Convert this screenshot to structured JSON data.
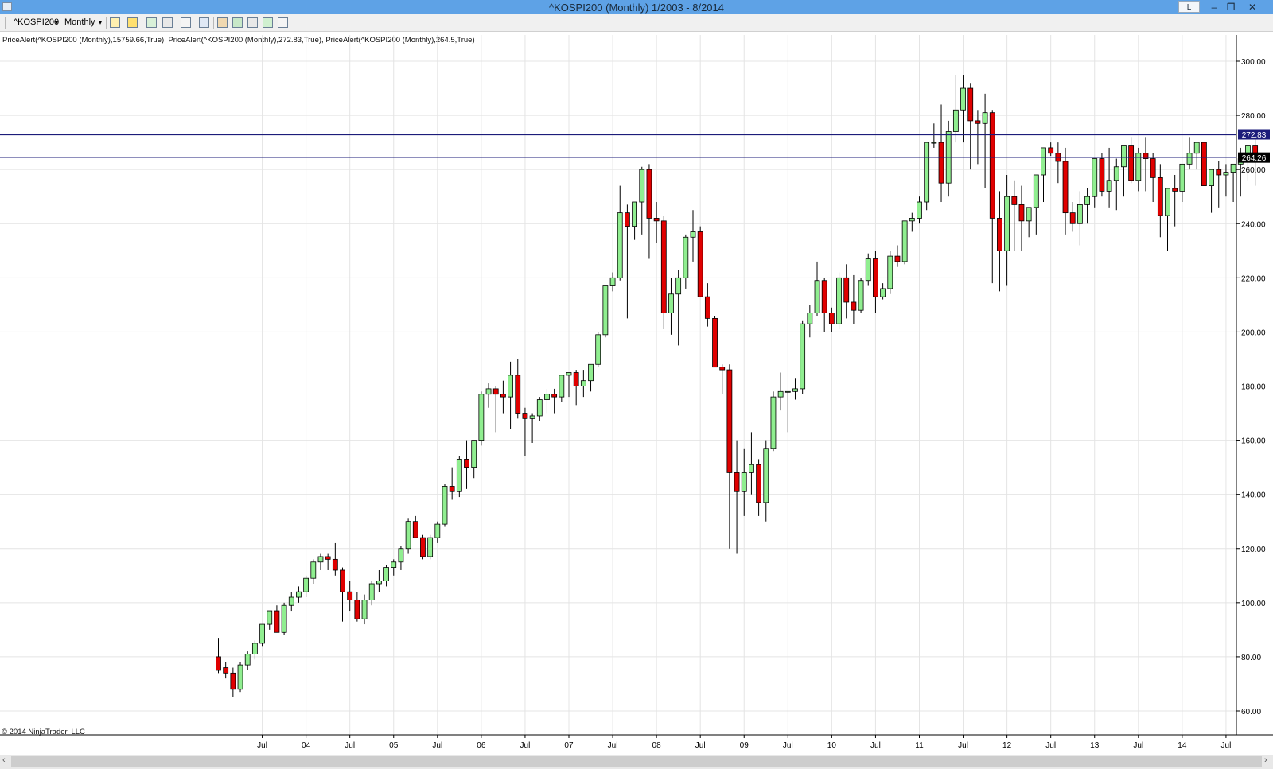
{
  "window": {
    "title": "^KOSPI200 (Monthly)  1/2003 - 8/2014",
    "btn_l": "L",
    "btn_min": "–",
    "btn_restore": "❐",
    "btn_close": "✕"
  },
  "toolbar": {
    "instrument": "^KOSPI200",
    "period": "Monthly",
    "icons": [
      "chart-style-icon",
      "drawing-pencil-icon",
      "indicator-icon",
      "strategy-icon",
      "cursor-icon",
      "zoom-icon",
      "data-box-icon",
      "properties-icon",
      "share-icon",
      "export-icon",
      "layout-icon"
    ]
  },
  "indicators_label": "PriceAlert(^KOSPI200 (Monthly),15759.66,True), PriceAlert(^KOSPI200 (Monthly),272.83,True), PriceAlert(^KOSPI200 (Monthly),264.5,True)",
  "copyright": "© 2014 NinjaTrader, LLC",
  "colors": {
    "up": "#90ee90",
    "down": "#e00000",
    "alert_line": "#1c1c7a",
    "alert_label_bg": "#1c1c7a",
    "last_label_bg": "#000000",
    "grid": "#e4e4e4"
  },
  "chart_data": {
    "type": "candlestick",
    "title": "^KOSPI200 (Monthly)  1/2003 - 8/2014",
    "ylim": [
      55,
      310
    ],
    "y_ticks": [
      "300.00",
      "280.00",
      "260.00",
      "240.00",
      "220.00",
      "200.00",
      "180.00",
      "160.00",
      "140.00",
      "120.00",
      "100.00",
      "80.00",
      "60.00"
    ],
    "x_tick_labels": [
      "Jul",
      "04",
      "Jul",
      "05",
      "Jul",
      "06",
      "Jul",
      "07",
      "Jul",
      "08",
      "Jul",
      "09",
      "Jul",
      "10",
      "Jul",
      "11",
      "Jul",
      "12",
      "Jul",
      "13",
      "Jul",
      "14",
      "Jul"
    ],
    "x_tick_months": [
      "2003-07",
      "2004-01",
      "2004-07",
      "2005-01",
      "2005-07",
      "2006-01",
      "2006-07",
      "2007-01",
      "2007-07",
      "2008-01",
      "2008-07",
      "2009-01",
      "2009-07",
      "2010-01",
      "2010-07",
      "2011-01",
      "2011-07",
      "2012-01",
      "2012-07",
      "2013-01",
      "2013-07",
      "2014-01",
      "2014-07"
    ],
    "first_month": "2003-01",
    "candles": [
      [
        80,
        87,
        74,
        75
      ],
      [
        76,
        78,
        72,
        74
      ],
      [
        74,
        76,
        65,
        68
      ],
      [
        68,
        78,
        67,
        77
      ],
      [
        77,
        82,
        75,
        81
      ],
      [
        81,
        86,
        79,
        85
      ],
      [
        85,
        92,
        84,
        92
      ],
      [
        92,
        97,
        90,
        97
      ],
      [
        97,
        99,
        89,
        89
      ],
      [
        89,
        100,
        88,
        99
      ],
      [
        99,
        104,
        97,
        102
      ],
      [
        102,
        106,
        100,
        104
      ],
      [
        104,
        110,
        102,
        109
      ],
      [
        109,
        116,
        107,
        115
      ],
      [
        115,
        118,
        112,
        117
      ],
      [
        117,
        118,
        112,
        116
      ],
      [
        116,
        122,
        110,
        112
      ],
      [
        112,
        113,
        93,
        104
      ],
      [
        104,
        108,
        97,
        101
      ],
      [
        101,
        104,
        93,
        94
      ],
      [
        94,
        103,
        92,
        101
      ],
      [
        101,
        108,
        99,
        107
      ],
      [
        107,
        112,
        104,
        108
      ],
      [
        108,
        114,
        106,
        113
      ],
      [
        113,
        116,
        110,
        115
      ],
      [
        115,
        121,
        112,
        120
      ],
      [
        120,
        131,
        118,
        130
      ],
      [
        130,
        132,
        124,
        124
      ],
      [
        124,
        125,
        116,
        117
      ],
      [
        117,
        125,
        116,
        124
      ],
      [
        124,
        130,
        122,
        129
      ],
      [
        129,
        144,
        128,
        143
      ],
      [
        143,
        150,
        138,
        141
      ],
      [
        141,
        154,
        139,
        153
      ],
      [
        153,
        160,
        142,
        150
      ],
      [
        150,
        160,
        146,
        160
      ],
      [
        160,
        178,
        158,
        177
      ],
      [
        177,
        181,
        172,
        179
      ],
      [
        179,
        180,
        163,
        177
      ],
      [
        177,
        182,
        170,
        176
      ],
      [
        176,
        189,
        164,
        184
      ],
      [
        184,
        190,
        168,
        170
      ],
      [
        170,
        172,
        154,
        168
      ],
      [
        168,
        170,
        159,
        169
      ],
      [
        169,
        176,
        167,
        175
      ],
      [
        175,
        179,
        170,
        177
      ],
      [
        177,
        179,
        170,
        176
      ],
      [
        176,
        184,
        174,
        184
      ],
      [
        184,
        185,
        176,
        185
      ],
      [
        185,
        186,
        173,
        180
      ],
      [
        180,
        186,
        176,
        182
      ],
      [
        182,
        188,
        178,
        188
      ],
      [
        188,
        200,
        187,
        199
      ],
      [
        199,
        217,
        198,
        217
      ],
      [
        217,
        222,
        215,
        220
      ],
      [
        220,
        254,
        219,
        244
      ],
      [
        244,
        247,
        205,
        239
      ],
      [
        239,
        247,
        234,
        248
      ],
      [
        248,
        261,
        236,
        260
      ],
      [
        260,
        262,
        227,
        242
      ],
      [
        242,
        248,
        233,
        241
      ],
      [
        241,
        243,
        201,
        207
      ],
      [
        207,
        220,
        199,
        214
      ],
      [
        214,
        223,
        195,
        220
      ],
      [
        220,
        236,
        216,
        235
      ],
      [
        235,
        245,
        226,
        237
      ],
      [
        237,
        239,
        213,
        213
      ],
      [
        213,
        218,
        202,
        205
      ],
      [
        205,
        206,
        187,
        187
      ],
      [
        187,
        188,
        177,
        186
      ],
      [
        186,
        188,
        120,
        148
      ],
      [
        148,
        160,
        118,
        141
      ],
      [
        141,
        157,
        132,
        148
      ],
      [
        148,
        163,
        140,
        151
      ],
      [
        151,
        153,
        132,
        137
      ],
      [
        137,
        160,
        130,
        157
      ],
      [
        157,
        178,
        156,
        176
      ],
      [
        176,
        185,
        171,
        178
      ],
      [
        178,
        178,
        163,
        178
      ],
      [
        178,
        183,
        175,
        179
      ],
      [
        179,
        204,
        177,
        203
      ],
      [
        203,
        210,
        198,
        207
      ],
      [
        207,
        226,
        206,
        219
      ],
      [
        219,
        220,
        200,
        207
      ],
      [
        207,
        209,
        200,
        203
      ],
      [
        203,
        222,
        201,
        220
      ],
      [
        220,
        225,
        205,
        211
      ],
      [
        211,
        221,
        203,
        208
      ],
      [
        208,
        220,
        207,
        219
      ],
      [
        219,
        229,
        217,
        227
      ],
      [
        227,
        230,
        207,
        213
      ],
      [
        213,
        218,
        212,
        216
      ],
      [
        216,
        230,
        214,
        228
      ],
      [
        228,
        232,
        224,
        226
      ],
      [
        226,
        240,
        225,
        241
      ],
      [
        241,
        244,
        237,
        242
      ],
      [
        242,
        250,
        240,
        248
      ],
      [
        248,
        265,
        245,
        270
      ],
      [
        270,
        277,
        268,
        270
      ],
      [
        270,
        284,
        248,
        255
      ],
      [
        255,
        278,
        250,
        274
      ],
      [
        274,
        295,
        270,
        282
      ],
      [
        282,
        295,
        270,
        290
      ],
      [
        290,
        292,
        260,
        278
      ],
      [
        278,
        282,
        262,
        277
      ],
      [
        277,
        288,
        253,
        281
      ],
      [
        281,
        282,
        218,
        242
      ],
      [
        242,
        252,
        215,
        230
      ],
      [
        230,
        258,
        217,
        250
      ],
      [
        250,
        256,
        230,
        247
      ],
      [
        247,
        254,
        230,
        241
      ],
      [
        241,
        245,
        235,
        246
      ],
      [
        246,
        256,
        236,
        258
      ],
      [
        258,
        263,
        248,
        268
      ],
      [
        268,
        270,
        265,
        266
      ],
      [
        266,
        270,
        255,
        263
      ],
      [
        263,
        268,
        236,
        244
      ],
      [
        244,
        248,
        237,
        240
      ],
      [
        240,
        252,
        232,
        247
      ],
      [
        247,
        253,
        240,
        250
      ],
      [
        250,
        260,
        246,
        264
      ],
      [
        264,
        266,
        250,
        252
      ],
      [
        252,
        268,
        246,
        256
      ],
      [
        256,
        264,
        245,
        261
      ],
      [
        261,
        266,
        250,
        269
      ],
      [
        269,
        272,
        255,
        256
      ],
      [
        256,
        268,
        252,
        266
      ],
      [
        266,
        272,
        252,
        264
      ],
      [
        264,
        266,
        248,
        257
      ],
      [
        257,
        262,
        235,
        243
      ],
      [
        243,
        251,
        230,
        253
      ],
      [
        253,
        258,
        239,
        252
      ],
      [
        252,
        260,
        248,
        262
      ],
      [
        262,
        272,
        260,
        266
      ],
      [
        266,
        270,
        260,
        270
      ],
      [
        270,
        270,
        255,
        254
      ],
      [
        254,
        259,
        244,
        260
      ],
      [
        260,
        263,
        246,
        258
      ],
      [
        258,
        262,
        250,
        259
      ],
      [
        259,
        262,
        248,
        262
      ],
      [
        262,
        268,
        250,
        264
      ],
      [
        264,
        268,
        256,
        269
      ],
      [
        269,
        273,
        254,
        264
      ]
    ],
    "price_alerts": [
      15759.66,
      272.83,
      264.5
    ],
    "alert_labels": [
      "272.83",
      "264.26"
    ]
  }
}
